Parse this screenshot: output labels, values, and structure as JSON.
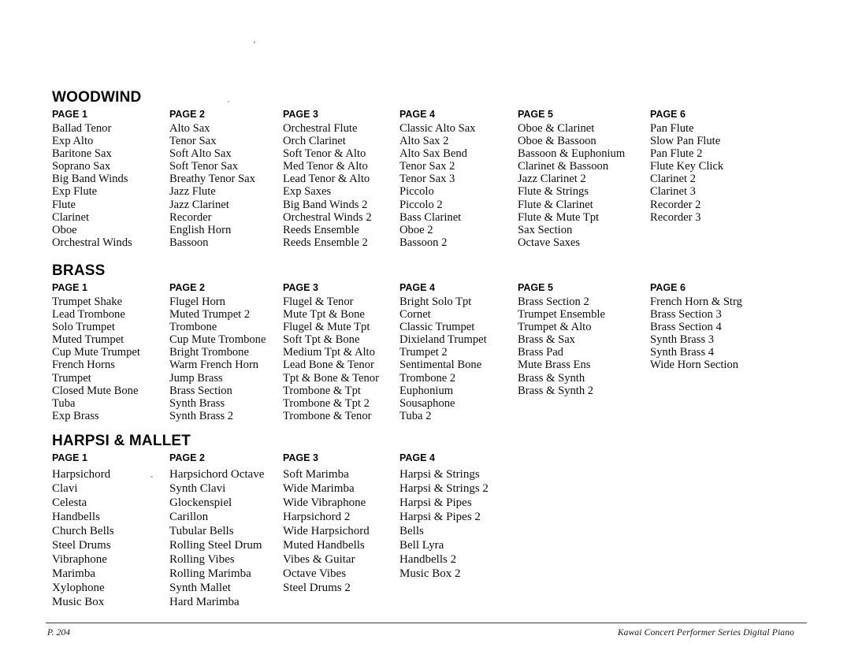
{
  "document": {
    "footer": {
      "page_label": "P. 204",
      "title": "Kawai Concert Performer Series Digital Piano"
    }
  },
  "sections": [
    {
      "id": "woodwind",
      "title": "WOODWIND",
      "columns": [
        {
          "header": "PAGE 1",
          "items": [
            "Ballad Tenor",
            "Exp Alto",
            "Baritone Sax",
            "Soprano Sax",
            "Big Band Winds",
            "Exp Flute",
            "Flute",
            "Clarinet",
            "Oboe",
            "Orchestral Winds"
          ]
        },
        {
          "header": "PAGE 2",
          "items": [
            "Alto Sax",
            "Tenor Sax",
            "Soft Alto Sax",
            "Soft Tenor Sax",
            "Breathy Tenor Sax",
            "Jazz Flute",
            "Jazz Clarinet",
            "Recorder",
            "English Horn",
            "Bassoon"
          ]
        },
        {
          "header": "PAGE 3",
          "items": [
            "Orchestral Flute",
            "Orch Clarinet",
            "Soft Tenor & Alto",
            "Med Tenor & Alto",
            "Lead Tenor & Alto",
            "Exp Saxes",
            "Big Band Winds 2",
            "Orchestral Winds 2",
            "Reeds Ensemble",
            "Reeds Ensemble 2"
          ]
        },
        {
          "header": "PAGE 4",
          "items": [
            "Classic Alto Sax",
            "Alto Sax 2",
            "Alto Sax Bend",
            "Tenor Sax 2",
            "Tenor Sax 3",
            "Piccolo",
            "Piccolo 2",
            "Bass Clarinet",
            "Oboe 2",
            "Bassoon 2"
          ]
        },
        {
          "header": "PAGE 5",
          "items": [
            "Oboe & Clarinet",
            "Oboe & Bassoon",
            "Bassoon & Euphonium",
            "Clarinet & Bassoon",
            "Jazz Clarinet 2",
            "Flute & Strings",
            "Flute & Clarinet",
            "Flute & Mute Tpt",
            "Sax Section",
            "Octave Saxes"
          ]
        },
        {
          "header": "PAGE 6",
          "items": [
            "Pan Flute",
            "Slow Pan Flute",
            "Pan Flute 2",
            "Flute Key Click",
            "Clarinet 2",
            "Clarinet 3",
            "Recorder 2",
            "Recorder 3"
          ]
        }
      ]
    },
    {
      "id": "brass",
      "title": "BRASS",
      "columns": [
        {
          "header": "PAGE 1",
          "items": [
            "Trumpet Shake",
            "Lead Trombone",
            "Solo Trumpet",
            "Muted Trumpet",
            "Cup Mute Trumpet",
            "French Horns",
            "Trumpet",
            "Closed Mute Bone",
            "Tuba",
            "Exp Brass"
          ]
        },
        {
          "header": "PAGE 2",
          "items": [
            "Flugel Horn",
            "Muted Trumpet 2",
            "Trombone",
            "Cup Mute Trombone",
            "Bright Trombone",
            "Warm French Horn",
            "Jump Brass",
            "Brass Section",
            "Synth Brass",
            "Synth Brass 2"
          ]
        },
        {
          "header": "PAGE 3",
          "items": [
            "Flugel & Tenor",
            "Mute Tpt & Bone",
            "Flugel & Mute Tpt",
            "Soft Tpt & Bone",
            "Medium Tpt & Alto",
            "Lead Bone & Tenor",
            "Tpt & Bone & Tenor",
            "Trombone & Tpt",
            "Trombone & Tpt 2",
            "Trombone & Tenor"
          ]
        },
        {
          "header": "PAGE 4",
          "items": [
            "Bright Solo Tpt",
            "Cornet",
            "Classic Trumpet",
            "Dixieland Trumpet",
            "Trumpet 2",
            "Sentimental Bone",
            "Trombone 2",
            "Euphonium",
            "Sousaphone",
            "Tuba 2"
          ]
        },
        {
          "header": "PAGE 5",
          "items": [
            "Brass Section 2",
            "Trumpet Ensemble",
            "Trumpet & Alto",
            "Brass & Sax",
            "Brass Pad",
            "Mute Brass Ens",
            "Brass & Synth",
            "Brass & Synth 2"
          ]
        },
        {
          "header": "PAGE 6",
          "items": [
            "French Horn & Strg",
            "Brass Section 3",
            "Brass Section 4",
            "Synth Brass 3",
            "Synth Brass 4",
            "Wide Horn Section"
          ]
        }
      ]
    },
    {
      "id": "harpsi",
      "title": "HARPSI & MALLET",
      "columns": [
        {
          "header": "PAGE 1",
          "items": [
            "Harpsichord",
            "Clavi",
            "Celesta",
            "Handbells",
            "Church Bells",
            "Steel Drums",
            "Vibraphone",
            "Marimba",
            "Xylophone",
            "Music Box"
          ]
        },
        {
          "header": "PAGE 2",
          "items": [
            "Harpsichord Octave",
            "Synth Clavi",
            "Glockenspiel",
            "Carillon",
            "Tubular Bells",
            "Rolling Steel Drum",
            "Rolling Vibes",
            "Rolling Marimba",
            "Synth Mallet",
            "Hard Marimba"
          ]
        },
        {
          "header": "PAGE 3",
          "items": [
            "Soft Marimba",
            "Wide Marimba",
            "Wide Vibraphone",
            "Harpsichord 2",
            "Wide Harpsichord",
            "Muted Handbells",
            "Vibes & Guitar",
            "Octave Vibes",
            "Steel Drums 2"
          ]
        },
        {
          "header": "PAGE 4",
          "items": [
            "Harpsi & Strings",
            "Harpsi & Strings 2",
            "Harpsi & Pipes",
            "Harpsi & Pipes 2",
            "Bells",
            "Bell Lyra",
            "Handbells 2",
            "Music Box 2"
          ]
        }
      ]
    }
  ]
}
